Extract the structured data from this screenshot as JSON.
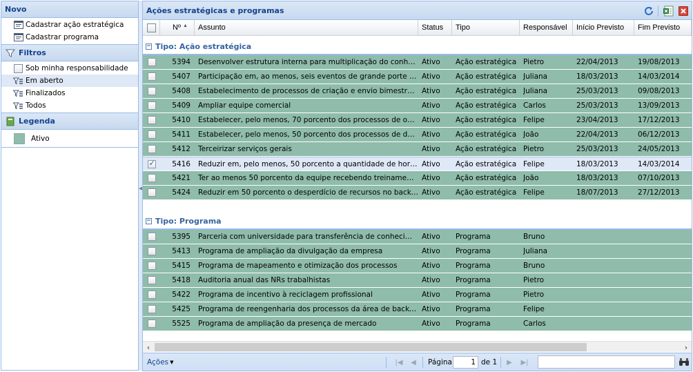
{
  "left": {
    "novo": {
      "title": "Novo",
      "items": [
        {
          "label": "Cadastrar ação estratégica",
          "icon": "form-icon"
        },
        {
          "label": "Cadastrar programa",
          "icon": "form-icon"
        }
      ]
    },
    "filtros": {
      "title": "Filtros",
      "items": [
        {
          "label": "Sob minha responsabilidade",
          "icon": "checkbox",
          "checked": false
        },
        {
          "label": "Em aberto",
          "icon": "filter-icon",
          "selected": true
        },
        {
          "label": "Finalizados",
          "icon": "filter-icon"
        },
        {
          "label": "Todos",
          "icon": "filter-icon"
        }
      ]
    },
    "legenda": {
      "title": "Legenda",
      "items": [
        {
          "label": "Ativo",
          "color": "#8fbcab"
        }
      ]
    }
  },
  "main": {
    "title": "Ações estratégicas e programas",
    "tools": [
      "refresh-icon",
      "export-excel-icon",
      "close-icon"
    ],
    "columns": [
      "",
      "Nº",
      "Assunto",
      "Status",
      "Tipo",
      "Responsável",
      "Início Previsto",
      "Fim Previsto"
    ],
    "sort_column": "Nº",
    "groups": [
      {
        "label": "Tipo: Ação estratégica",
        "rows": [
          {
            "checked": false,
            "num": "5394",
            "assunto": "Desenvolver estrutura interna para multiplicação do conhecim...",
            "status": "Ativo",
            "tipo": "Ação estratégica",
            "resp": "Pietro",
            "inicio": "22/04/2013",
            "fim": "19/08/2013"
          },
          {
            "checked": false,
            "num": "5407",
            "assunto": "Participação em, ao menos, seis eventos de grande porte ao l...",
            "status": "Ativo",
            "tipo": "Ação estratégica",
            "resp": "Juliana",
            "inicio": "18/03/2013",
            "fim": "14/03/2014"
          },
          {
            "checked": false,
            "num": "5408",
            "assunto": "Estabelecimento de processos de criação e envio bimestral de...",
            "status": "Ativo",
            "tipo": "Ação estratégica",
            "resp": "Juliana",
            "inicio": "25/03/2013",
            "fim": "09/08/2013"
          },
          {
            "checked": false,
            "num": "5409",
            "assunto": "Ampliar equipe comercial",
            "status": "Ativo",
            "tipo": "Ação estratégica",
            "resp": "Carlos",
            "inicio": "25/03/2013",
            "fim": "13/09/2013"
          },
          {
            "checked": false,
            "num": "5410",
            "assunto": "Estabelecer, pelo menos, 70 porcento dos processos de oper...",
            "status": "Ativo",
            "tipo": "Ação estratégica",
            "resp": "Felipe",
            "inicio": "23/04/2013",
            "fim": "17/12/2013"
          },
          {
            "checked": false,
            "num": "5411",
            "assunto": "Estabelecer, pelo menos, 50 porcento dos processos de dese...",
            "status": "Ativo",
            "tipo": "Ação estratégica",
            "resp": "João",
            "inicio": "22/04/2013",
            "fim": "06/12/2013"
          },
          {
            "checked": false,
            "num": "5412",
            "assunto": "Terceirizar serviços gerais",
            "status": "Ativo",
            "tipo": "Ação estratégica",
            "resp": "Pietro",
            "inicio": "25/03/2013",
            "fim": "24/05/2013"
          },
          {
            "checked": true,
            "selected": true,
            "num": "5416",
            "assunto": "Reduzir em, pelo menos, 50 porcento a quantidade de horas e...",
            "status": "Ativo",
            "tipo": "Ação estratégica",
            "resp": "Felipe",
            "inicio": "18/03/2013",
            "fim": "14/03/2014"
          },
          {
            "checked": false,
            "num": "5421",
            "assunto": "Ter ao menos 50 porcento da equipe recebendo treinamento e...",
            "status": "Ativo",
            "tipo": "Ação estratégica",
            "resp": "João",
            "inicio": "18/03/2013",
            "fim": "07/10/2013"
          },
          {
            "checked": false,
            "num": "5424",
            "assunto": "Reduzir em 50 porcento o desperdício de recursos no backoffi...",
            "status": "Ativo",
            "tipo": "Ação estratégica",
            "resp": "Felipe",
            "inicio": "18/07/2013",
            "fim": "27/12/2013"
          }
        ]
      },
      {
        "label": "Tipo: Programa",
        "rows": [
          {
            "checked": false,
            "num": "5395",
            "assunto": "Parceria com universidade para transferência de conhecimento",
            "status": "Ativo",
            "tipo": "Programa",
            "resp": "Bruno",
            "inicio": "",
            "fim": ""
          },
          {
            "checked": false,
            "num": "5413",
            "assunto": "Programa de ampliação da divulgação da empresa",
            "status": "Ativo",
            "tipo": "Programa",
            "resp": "Juliana",
            "inicio": "",
            "fim": ""
          },
          {
            "checked": false,
            "num": "5415",
            "assunto": "Programa de mapeamento e otimização dos processos",
            "status": "Ativo",
            "tipo": "Programa",
            "resp": "Bruno",
            "inicio": "",
            "fim": ""
          },
          {
            "checked": false,
            "num": "5418",
            "assunto": "Auditoria anual das NRs trabalhistas",
            "status": "Ativo",
            "tipo": "Programa",
            "resp": "Pietro",
            "inicio": "",
            "fim": ""
          },
          {
            "checked": false,
            "num": "5422",
            "assunto": "Programa de incentivo à reciclagem profissional",
            "status": "Ativo",
            "tipo": "Programa",
            "resp": "Pietro",
            "inicio": "",
            "fim": ""
          },
          {
            "checked": false,
            "num": "5425",
            "assunto": "Programa de reengenharia dos processos da área de backoffice",
            "status": "Ativo",
            "tipo": "Programa",
            "resp": "Felipe",
            "inicio": "",
            "fim": ""
          },
          {
            "checked": false,
            "num": "5525",
            "assunto": "Programa de ampliação da presença de mercado",
            "status": "Ativo",
            "tipo": "Programa",
            "resp": "Carlos",
            "inicio": "",
            "fim": ""
          }
        ]
      }
    ]
  },
  "bottom": {
    "acoes_label": "Ações",
    "pagina_label": "Página",
    "page_value": "1",
    "de_label": "de 1",
    "search_value": ""
  },
  "colors": {
    "row_active": "#8fbcab",
    "header_blue": "#15428b",
    "border": "#99bbe8"
  }
}
